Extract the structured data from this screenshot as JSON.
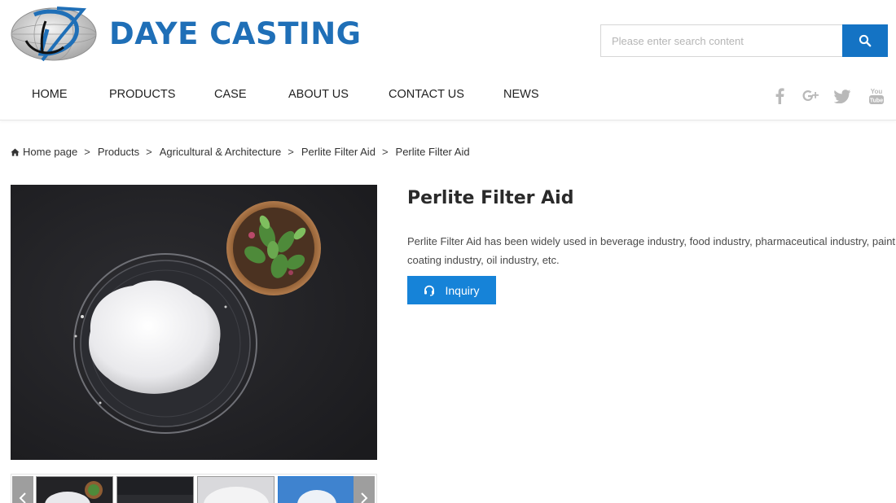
{
  "header": {
    "brand": "DAYE CASTING",
    "search": {
      "placeholder": "Please enter search content"
    }
  },
  "nav": {
    "items": [
      {
        "label": "HOME"
      },
      {
        "label": "PRODUCTS"
      },
      {
        "label": "CASE"
      },
      {
        "label": "ABOUT US"
      },
      {
        "label": "CONTACT US"
      },
      {
        "label": "NEWS"
      }
    ]
  },
  "social": [
    "facebook-icon",
    "google-plus-icon",
    "twitter-icon",
    "youtube-icon"
  ],
  "breadcrumb": {
    "items": [
      "Home page",
      "Products",
      "Agricultural & Architecture",
      "Perlite Filter Aid",
      "Perlite Filter Aid"
    ],
    "separator": ">"
  },
  "product": {
    "title": "Perlite Filter Aid",
    "description": "Perlite Filter Aid  has been widely used in beverage industry, food industry, pharmaceutical industry, paint coating industry, oil industry, etc.",
    "inquiry_label": "Inquiry"
  },
  "colors": {
    "brand_blue": "#1f6fb7",
    "button_blue": "#1683d8",
    "search_blue": "#1473c4"
  }
}
